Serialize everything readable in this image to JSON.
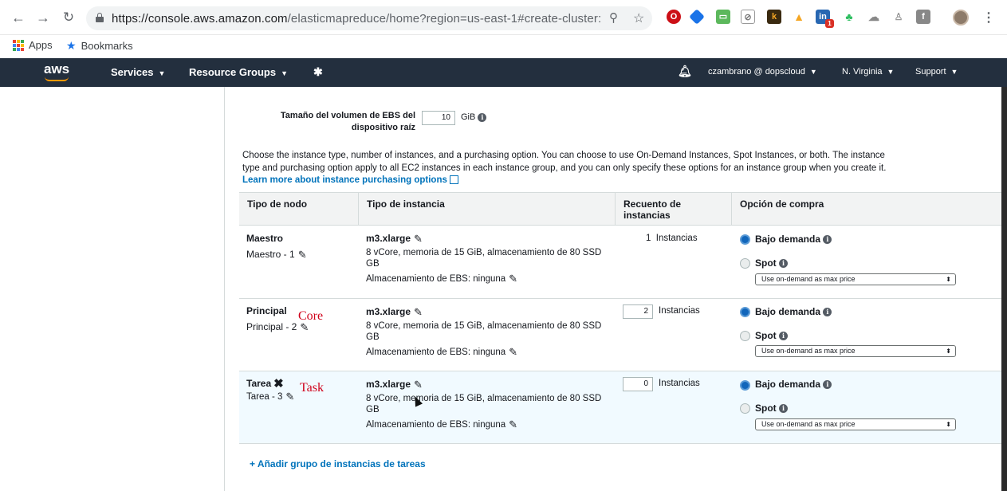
{
  "browser": {
    "url_host": "https://console.aws.amazon.com",
    "url_path": "/elasticmapreduce/home?region=us-east-1#create-cluster:",
    "bookmarks": [
      {
        "label": "Apps"
      },
      {
        "label": "Bookmarks"
      }
    ],
    "extension_badge": "1"
  },
  "aws_nav": {
    "logo": "aws",
    "services": "Services",
    "resource_groups": "Resource Groups",
    "user": "czambrano @ dopscloud",
    "region": "N. Virginia",
    "support": "Support"
  },
  "ebs": {
    "label": "Tamaño del volumen de EBS del dispositivo raíz",
    "value": "10",
    "unit": "GiB"
  },
  "description": {
    "text": "Choose the instance type, number of instances, and a purchasing option. You can choose to use On-Demand Instances, Spot Instances, or both. The instance type and purchasing option apply to all EC2 instances in each instance group, and you can only specify these options for an instance group when you create it. ",
    "link": "Learn more about instance purchasing options"
  },
  "table": {
    "headers": [
      "Tipo de nodo",
      "Tipo de instancia",
      "Recuento de instancias",
      "Opción de compra"
    ],
    "rows": [
      {
        "node_name": "Maestro",
        "node_sub": "Maestro - 1",
        "instance_type": "m3.xlarge",
        "instance_desc": "8 vCore, memoria de 15 GiB, almacenamiento de 80 SSD GB",
        "ebs": "Almacenamiento de EBS:  ninguna",
        "count": "1",
        "count_unit": "Instancias",
        "option_ondemand": "Bajo demanda",
        "option_spot": "Spot",
        "select_value": "Use on-demand as max price",
        "annotation": ""
      },
      {
        "node_name": "Principal",
        "node_sub": "Principal - 2",
        "instance_type": "m3.xlarge",
        "instance_desc": "8 vCore, memoria de 15 GiB, almacenamiento de 80 SSD GB",
        "ebs": "Almacenamiento de EBS:  ninguna",
        "count": "2",
        "count_unit": "Instancias",
        "option_ondemand": "Bajo demanda",
        "option_spot": "Spot",
        "select_value": "Use on-demand as max price",
        "annotation": "Core"
      },
      {
        "node_name": "Tarea",
        "node_sub": "Tarea - 3",
        "instance_type": "m3.xlarge",
        "instance_desc": "8 vCore, memoria de 15 GiB, almacenamiento de 80 SSD GB",
        "ebs": "Almacenamiento de EBS:  ninguna",
        "count": "0",
        "count_unit": "Instancias",
        "option_ondemand": "Bajo demanda",
        "option_spot": "Spot",
        "select_value": "Use on-demand as max price",
        "annotation": "Task"
      }
    ]
  },
  "add_link": "+ Añadir grupo de instancias de tareas",
  "colors": {
    "aws_nav_bg": "#232f3e",
    "aws_orange": "#ff9900",
    "link_blue": "#0073bb",
    "annotation_red": "#d0021b"
  }
}
